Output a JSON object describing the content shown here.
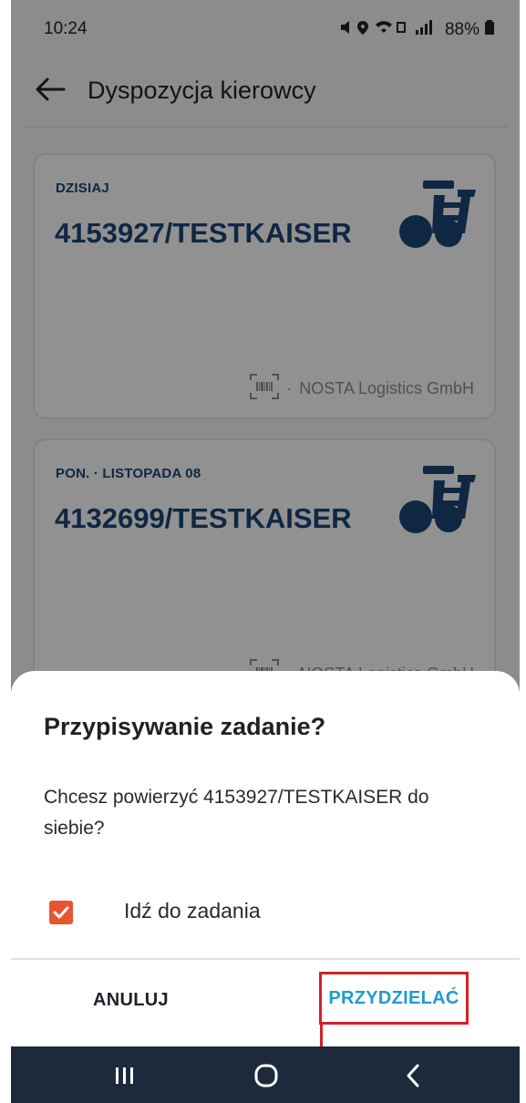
{
  "status_bar": {
    "time": "10:24",
    "battery": "88%"
  },
  "app_bar": {
    "title": "Dyspozycja kierowcy"
  },
  "cards": [
    {
      "date": "DZISIAJ",
      "number": "4153927/TESTKAISER",
      "company": "NOSTA Logistics GmbH",
      "separator": "·"
    },
    {
      "date": "PON. · LISTOPADA 08",
      "number": "4132699/TESTKAISER",
      "company": "NOSTA Logistics GmbH",
      "separator": "·"
    }
  ],
  "dialog": {
    "title": "Przypisywanie zadanie?",
    "message": "Chcesz powierzyć 4153927/TESTKAISER do siebie?",
    "checkbox_label": "Idź do zadania",
    "checkbox_checked": true,
    "cancel_label": "ANULUJ",
    "confirm_label": "PRZYDZIELAĆ"
  },
  "colors": {
    "card_text": "#1b4677",
    "checkbox": "#e8552f",
    "confirm": "#1f9bd1",
    "highlight": "#d4202a",
    "nav_bar": "#1d2a3b"
  }
}
